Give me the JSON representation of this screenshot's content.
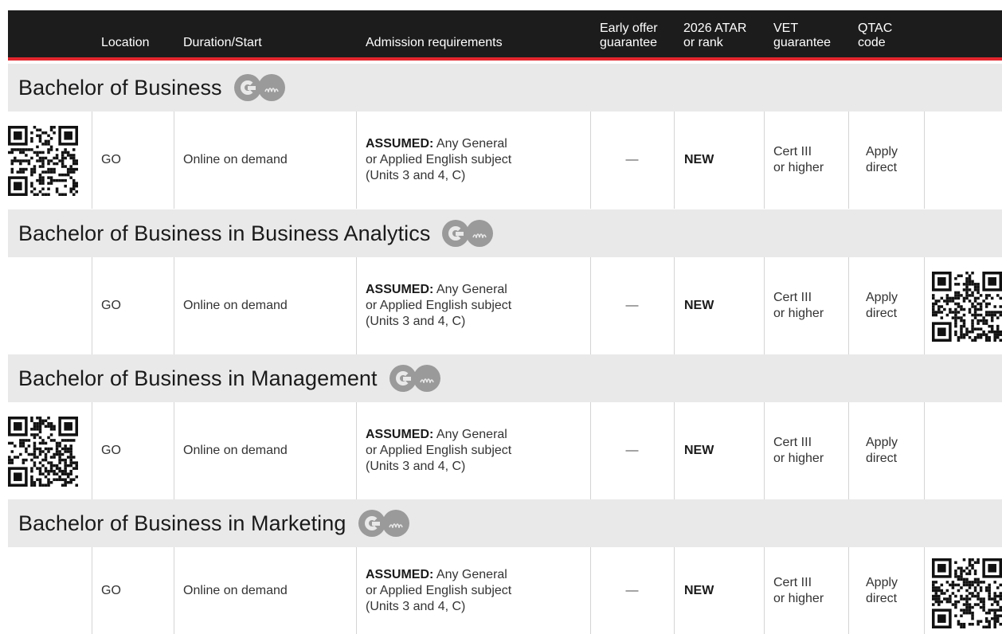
{
  "header": {
    "location": "Location",
    "duration": "Duration/Start",
    "admission": "Admission requirements",
    "early_line1": "Early offer",
    "early_line2": "guarantee",
    "atar_line1": "2026 ATAR",
    "atar_line2": "or rank",
    "vet_line1": "VET",
    "vet_line2": "guarantee",
    "qtac_line1": "QTAC",
    "qtac_line2": "code"
  },
  "programs": [
    {
      "title": "Bachelor of Business",
      "location": "GO",
      "duration": "Online on demand",
      "req_label": "ASSUMED:",
      "req_line1": " Any General",
      "req_line2": "or Applied English subject",
      "req_line3": "(Units 3 and 4, C)",
      "early_offer": "—",
      "atar": "NEW",
      "vet_line1": "Cert III",
      "vet_line2": "or higher",
      "qtac_line1": "Apply",
      "qtac_line2": "direct"
    },
    {
      "title": "Bachelor of Business in Business Analytics",
      "location": "GO",
      "duration": "Online on demand",
      "req_label": "ASSUMED:",
      "req_line1": " Any General",
      "req_line2": "or Applied English subject",
      "req_line3": "(Units 3 and 4, C)",
      "early_offer": "—",
      "atar": "NEW",
      "vet_line1": "Cert III",
      "vet_line2": "or higher",
      "qtac_line1": "Apply",
      "qtac_line2": "direct"
    },
    {
      "title": "Bachelor of Business in Management",
      "location": "GO",
      "duration": "Online on demand",
      "req_label": "ASSUMED:",
      "req_line1": " Any General",
      "req_line2": "or Applied English subject",
      "req_line3": "(Units 3 and 4, C)",
      "early_offer": "—",
      "atar": "NEW",
      "vet_line1": "Cert III",
      "vet_line2": "or higher",
      "qtac_line1": "Apply",
      "qtac_line2": "direct"
    },
    {
      "title": "Bachelor of Business in Marketing",
      "location": "GO",
      "duration": "Online on demand",
      "req_label": "ASSUMED:",
      "req_line1": " Any General",
      "req_line2": "or Applied English subject",
      "req_line3": "(Units 3 and 4, C)",
      "early_offer": "—",
      "atar": "NEW",
      "vet_line1": "Cert III",
      "vet_line2": "or higher",
      "qtac_line1": "Apply",
      "qtac_line2": "direct"
    }
  ],
  "colors": {
    "header_bg": "#1c1c1c",
    "accent_red": "#e3262e",
    "section_bg": "#e9e9ea",
    "badge_grey": "#9a9a9a"
  },
  "icons": {
    "go_badge": "go-logo-icon",
    "qr": "qr-code-icon"
  }
}
